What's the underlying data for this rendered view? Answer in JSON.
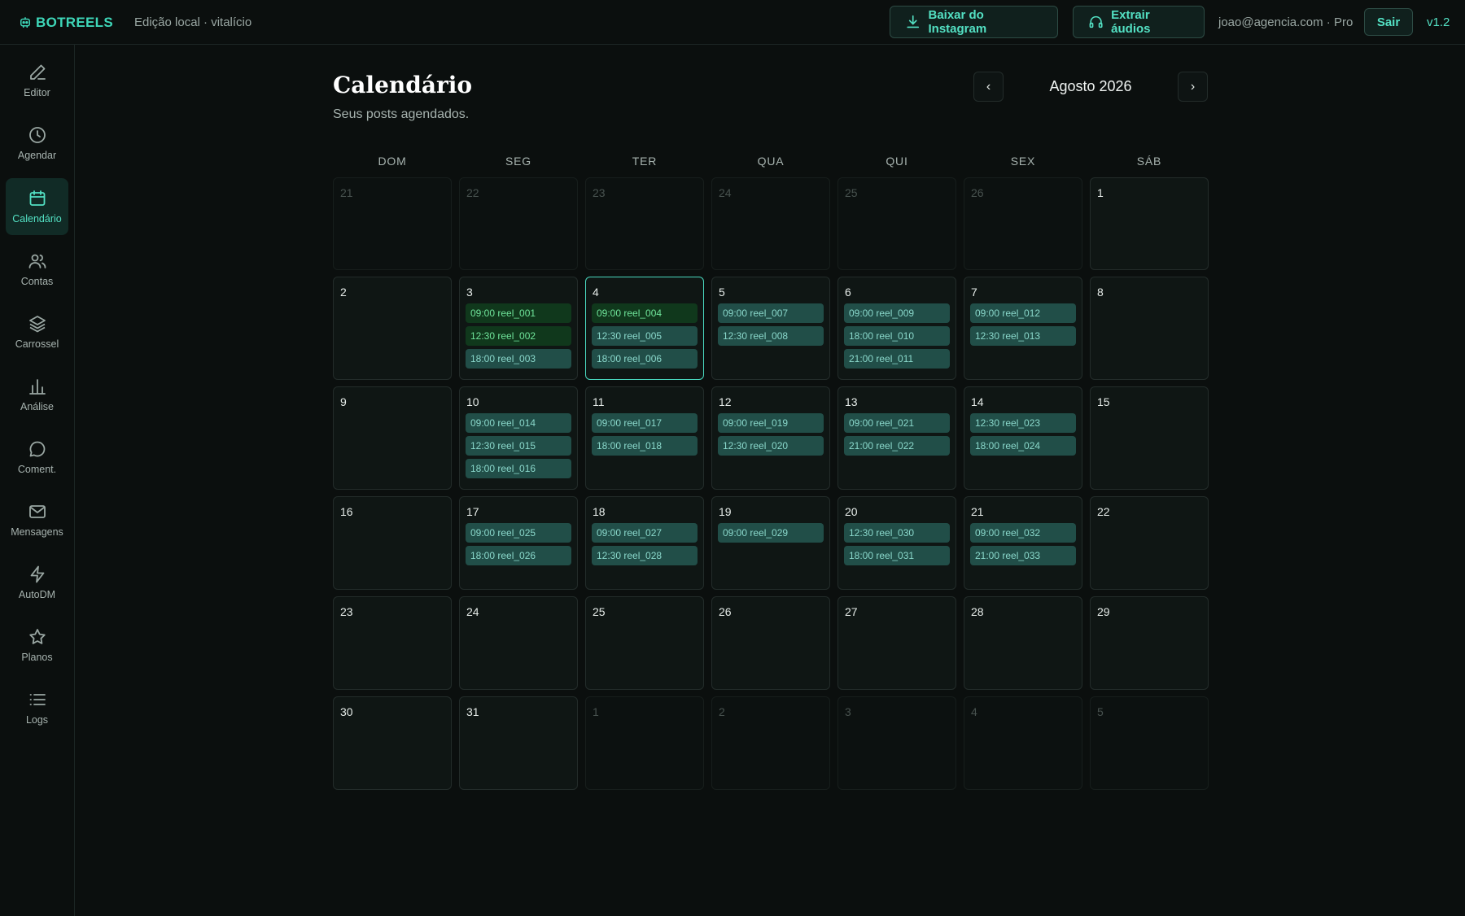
{
  "header": {
    "logo": "BOTREELS",
    "edition": "Edição local · vitalício",
    "download_label": "Baixar do Instagram",
    "audio_label": "Extrair áudios",
    "user": "joao@agencia.com · Pro",
    "logout_label": "Sair",
    "version": "v1.2"
  },
  "sidebar": {
    "items": [
      {
        "id": "editor",
        "label": "Editor",
        "icon": "pencil-icon"
      },
      {
        "id": "agendar",
        "label": "Agendar",
        "icon": "clock-icon"
      },
      {
        "id": "calendario",
        "label": "Calendário",
        "icon": "calendar-icon",
        "active": true
      },
      {
        "id": "contas",
        "label": "Contas",
        "icon": "users-icon"
      },
      {
        "id": "carrossel",
        "label": "Carrossel",
        "icon": "layers-icon"
      },
      {
        "id": "analise",
        "label": "Análise",
        "icon": "bar-chart-icon"
      },
      {
        "id": "coment",
        "label": "Coment.",
        "icon": "comment-icon"
      },
      {
        "id": "mensagens",
        "label": "Mensagens",
        "icon": "mail-icon"
      },
      {
        "id": "autodm",
        "label": "AutoDM",
        "icon": "lightning-icon"
      },
      {
        "id": "planos",
        "label": "Planos",
        "icon": "star-icon"
      },
      {
        "id": "logs",
        "label": "Logs",
        "icon": "list-icon"
      }
    ]
  },
  "main": {
    "title": "Calendário",
    "subtitle": "Seus posts agendados.",
    "month": "Agosto 2026",
    "prev_label": "‹",
    "next_label": "›"
  },
  "calendar": {
    "weekdays": [
      "DOM",
      "SEG",
      "TER",
      "QUA",
      "QUI",
      "SEX",
      "SÁB"
    ],
    "weeks": [
      [
        {
          "n": "21",
          "muted": true,
          "posts": []
        },
        {
          "n": "22",
          "muted": true,
          "posts": []
        },
        {
          "n": "23",
          "muted": true,
          "posts": []
        },
        {
          "n": "24",
          "muted": true,
          "posts": []
        },
        {
          "n": "25",
          "muted": true,
          "posts": []
        },
        {
          "n": "26",
          "muted": true,
          "posts": []
        },
        {
          "n": "1",
          "posts": []
        }
      ],
      [
        {
          "n": "2",
          "posts": []
        },
        {
          "n": "3",
          "posts": [
            {
              "text": "09:00 reel_001",
              "status": "ok"
            },
            {
              "text": "12:30 reel_002",
              "status": "ok"
            },
            {
              "text": "18:00 reel_003",
              "status": "sched"
            }
          ]
        },
        {
          "n": "4",
          "today": true,
          "posts": [
            {
              "text": "09:00 reel_004",
              "status": "ok"
            },
            {
              "text": "12:30 reel_005",
              "status": "sched"
            },
            {
              "text": "18:00 reel_006",
              "status": "sched"
            }
          ]
        },
        {
          "n": "5",
          "posts": [
            {
              "text": "09:00 reel_007",
              "status": "sched"
            },
            {
              "text": "12:30 reel_008",
              "status": "sched"
            }
          ]
        },
        {
          "n": "6",
          "posts": [
            {
              "text": "09:00 reel_009",
              "status": "sched"
            },
            {
              "text": "18:00 reel_010",
              "status": "sched"
            },
            {
              "text": "21:00 reel_011",
              "status": "sched"
            }
          ]
        },
        {
          "n": "7",
          "posts": [
            {
              "text": "09:00 reel_012",
              "status": "sched"
            },
            {
              "text": "12:30 reel_013",
              "status": "sched"
            }
          ]
        },
        {
          "n": "8",
          "posts": []
        }
      ],
      [
        {
          "n": "9",
          "posts": []
        },
        {
          "n": "10",
          "posts": [
            {
              "text": "09:00 reel_014",
              "status": "sched"
            },
            {
              "text": "12:30 reel_015",
              "status": "sched"
            },
            {
              "text": "18:00 reel_016",
              "status": "sched"
            }
          ]
        },
        {
          "n": "11",
          "posts": [
            {
              "text": "09:00 reel_017",
              "status": "sched"
            },
            {
              "text": "18:00 reel_018",
              "status": "sched"
            }
          ]
        },
        {
          "n": "12",
          "posts": [
            {
              "text": "09:00 reel_019",
              "status": "sched"
            },
            {
              "text": "12:30 reel_020",
              "status": "sched"
            }
          ]
        },
        {
          "n": "13",
          "posts": [
            {
              "text": "09:00 reel_021",
              "status": "sched"
            },
            {
              "text": "21:00 reel_022",
              "status": "sched"
            }
          ]
        },
        {
          "n": "14",
          "posts": [
            {
              "text": "12:30 reel_023",
              "status": "sched"
            },
            {
              "text": "18:00 reel_024",
              "status": "sched"
            }
          ]
        },
        {
          "n": "15",
          "posts": []
        }
      ],
      [
        {
          "n": "16",
          "posts": []
        },
        {
          "n": "17",
          "posts": [
            {
              "text": "09:00 reel_025",
              "status": "sched"
            },
            {
              "text": "18:00 reel_026",
              "status": "sched"
            }
          ]
        },
        {
          "n": "18",
          "posts": [
            {
              "text": "09:00 reel_027",
              "status": "sched"
            },
            {
              "text": "12:30 reel_028",
              "status": "sched"
            }
          ]
        },
        {
          "n": "19",
          "posts": [
            {
              "text": "09:00 reel_029",
              "status": "sched"
            }
          ]
        },
        {
          "n": "20",
          "posts": [
            {
              "text": "12:30 reel_030",
              "status": "sched"
            },
            {
              "text": "18:00 reel_031",
              "status": "sched"
            }
          ]
        },
        {
          "n": "21",
          "posts": [
            {
              "text": "09:00 reel_032",
              "status": "sched"
            },
            {
              "text": "21:00 reel_033",
              "status": "sched"
            }
          ]
        },
        {
          "n": "22",
          "posts": []
        }
      ],
      [
        {
          "n": "23",
          "posts": []
        },
        {
          "n": "24",
          "posts": []
        },
        {
          "n": "25",
          "posts": []
        },
        {
          "n": "26",
          "posts": []
        },
        {
          "n": "27",
          "posts": []
        },
        {
          "n": "28",
          "posts": []
        },
        {
          "n": "29",
          "posts": []
        }
      ],
      [
        {
          "n": "30",
          "posts": []
        },
        {
          "n": "31",
          "posts": []
        },
        {
          "n": "1",
          "muted": true,
          "posts": []
        },
        {
          "n": "2",
          "muted": true,
          "posts": []
        },
        {
          "n": "3",
          "muted": true,
          "posts": []
        },
        {
          "n": "4",
          "muted": true,
          "posts": []
        },
        {
          "n": "5",
          "muted": true,
          "posts": []
        }
      ]
    ]
  },
  "colors": {
    "accent": "#53e0c3",
    "background": "#0b0f0e",
    "post_published": "#10381c",
    "post_scheduled": "#214e48",
    "today_border": "#49d6bd"
  }
}
